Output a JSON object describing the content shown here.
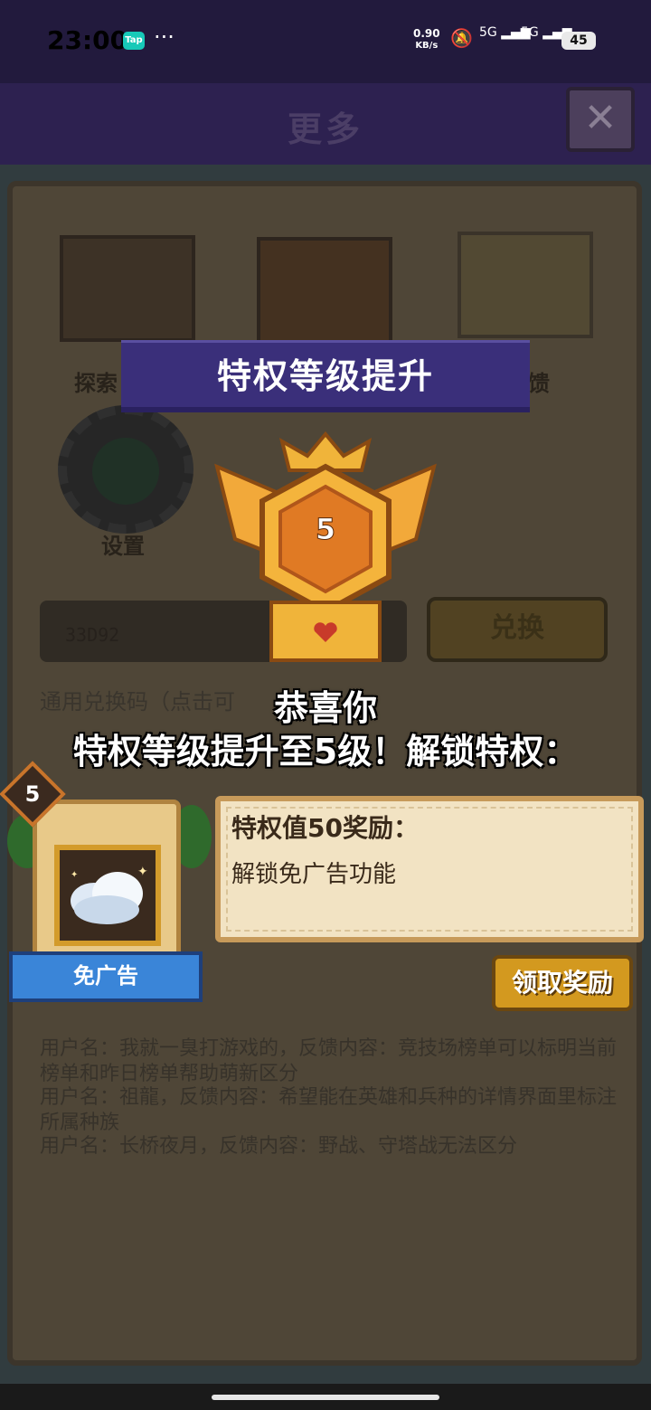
{
  "status_bar": {
    "time": "23:00",
    "app_badge": "Tap",
    "more": "···",
    "net_speed_value": "0.90",
    "net_speed_unit": "KB/s",
    "sim1": "5G",
    "sim2": "5G",
    "battery": "45"
  },
  "header": {
    "title": "更多",
    "close_symbol": "✕"
  },
  "background_page": {
    "menu_items": [
      {
        "label": "探索",
        "icon": "skull-book-icon"
      },
      {
        "label": "",
        "icon": "scroll-seal-icon"
      },
      {
        "label": "馈",
        "icon": "parchment-icon"
      },
      {
        "label": "设置",
        "icon": "gear-icon"
      }
    ],
    "code_input_lines": [
      "",
      "33D92"
    ],
    "exchange_button": "兑换",
    "redeem_hint": "通用兑换码（点击可",
    "feedback_lines": [
      "用户名：我就一臭打游戏的，反馈内容：竞技场榜单可以标明当前榜单和昨日榜单帮助萌新区分",
      "用户名：祖龍，反馈内容：希望能在英雄和兵种的详情界面里标注所属种族",
      "用户名：长桥夜月，反馈内容：野战、守塔战无法区分"
    ]
  },
  "popup": {
    "banner_title": "特权等级提升",
    "badge_level": "5",
    "congrats_line1": "恭喜你",
    "congrats_line2": "特权等级提升至5级！解锁特权：",
    "card_level": "5",
    "card_label": "免广告",
    "card_icon": "cloud-icon",
    "reward_title": "特权值50奖励：",
    "reward_body": "解锁免广告功能",
    "claim_button": "领取奖励"
  },
  "colors": {
    "banner": "#3a2f7a",
    "gold": "#d3991f",
    "parchment": "#f2e3c3"
  }
}
